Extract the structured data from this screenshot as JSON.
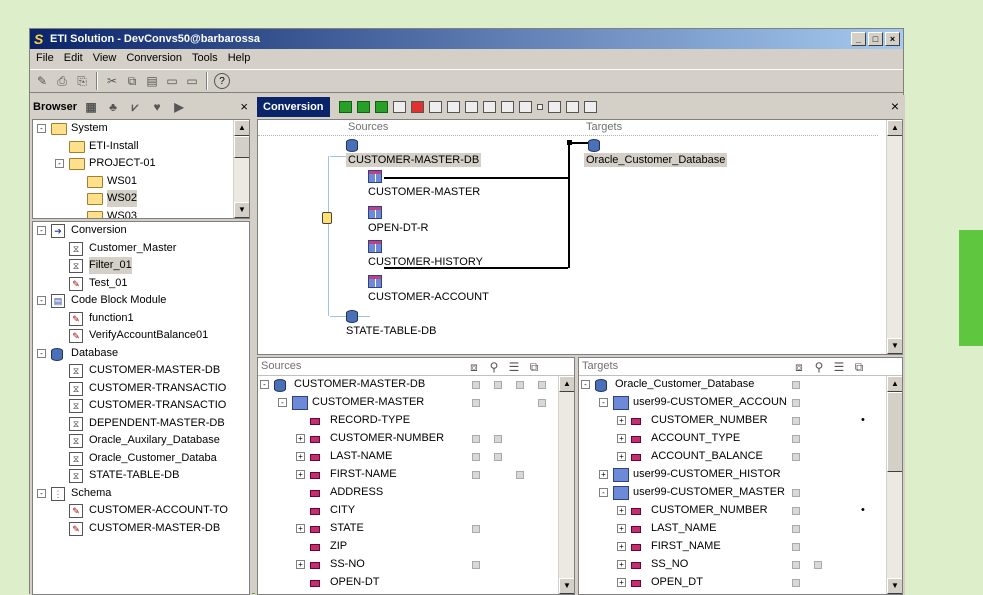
{
  "window": {
    "title": "ETI Solution - DevConvs50@barbarossa",
    "logo": "S"
  },
  "menu": [
    "File",
    "Edit",
    "View",
    "Conversion",
    "Tools",
    "Help"
  ],
  "browser": {
    "title": "Browser",
    "tree1": [
      {
        "label": "System",
        "depth": 0,
        "icon": "folder-icon",
        "exp": "-"
      },
      {
        "label": "ETI-Install",
        "depth": 1,
        "icon": "folder-icon"
      },
      {
        "label": "PROJECT-01",
        "depth": 1,
        "icon": "folder-icon",
        "exp": "-"
      },
      {
        "label": "WS01",
        "depth": 2,
        "icon": "folder-icon"
      },
      {
        "label": "WS02",
        "depth": 2,
        "icon": "folder-icon",
        "sel": true
      },
      {
        "label": "WS03",
        "depth": 2,
        "icon": "folder-icon"
      }
    ],
    "tree2": [
      {
        "label": "Conversion",
        "depth": 0,
        "icon": "conversion-icon",
        "exp": "-"
      },
      {
        "label": "Customer_Master",
        "depth": 1,
        "icon": "filter-doc-icon"
      },
      {
        "label": "Filter_01",
        "depth": 1,
        "icon": "filter-doc-icon",
        "sel": true
      },
      {
        "label": "Test_01",
        "depth": 1,
        "icon": "edit-doc-icon"
      },
      {
        "label": "Code Block Module",
        "depth": 0,
        "icon": "module-icon",
        "exp": "-"
      },
      {
        "label": "function1",
        "depth": 1,
        "icon": "edit-doc-icon"
      },
      {
        "label": "VerifyAccountBalance01",
        "depth": 1,
        "icon": "edit-doc-icon"
      },
      {
        "label": "Database",
        "depth": 0,
        "icon": "database-icon",
        "exp": "-"
      },
      {
        "label": "CUSTOMER-MASTER-DB",
        "depth": 1,
        "icon": "filter-doc-icon"
      },
      {
        "label": "CUSTOMER-TRANSACTIO",
        "depth": 1,
        "icon": "filter-doc-icon"
      },
      {
        "label": "CUSTOMER-TRANSACTIO",
        "depth": 1,
        "icon": "filter-doc-icon"
      },
      {
        "label": "DEPENDENT-MASTER-DB",
        "depth": 1,
        "icon": "filter-doc-icon"
      },
      {
        "label": "Oracle_Auxilary_Database",
        "depth": 1,
        "icon": "filter-doc-icon"
      },
      {
        "label": "Oracle_Customer_Databa",
        "depth": 1,
        "icon": "filter-doc-icon"
      },
      {
        "label": "STATE-TABLE-DB",
        "depth": 1,
        "icon": "filter-doc-icon"
      },
      {
        "label": "Schema",
        "depth": 0,
        "icon": "schema-icon",
        "exp": "-"
      },
      {
        "label": "CUSTOMER-ACCOUNT-TO",
        "depth": 1,
        "icon": "edit-doc-icon"
      },
      {
        "label": "CUSTOMER-MASTER-DB",
        "depth": 1,
        "icon": "edit-doc-icon"
      }
    ]
  },
  "conversion": {
    "title": "Conversion"
  },
  "diagram": {
    "sources_label": "Sources",
    "targets_label": "Targets",
    "source_db": "CUSTOMER-MASTER-DB",
    "target_db": "Oracle_Customer_Database",
    "tables": [
      "CUSTOMER-MASTER",
      "OPEN-DT-R",
      "CUSTOMER-HISTORY",
      "CUSTOMER-ACCOUNT"
    ],
    "state_db": "STATE-TABLE-DB"
  },
  "sources_panel": {
    "header": "Sources",
    "rows": [
      {
        "label": "CUSTOMER-MASTER-DB",
        "depth": 0,
        "kind": "db",
        "exp": "-",
        "checks": [
          1,
          1,
          1,
          1
        ]
      },
      {
        "label": "CUSTOMER-MASTER",
        "depth": 1,
        "kind": "table",
        "exp": "-",
        "checks": [
          1,
          0,
          0,
          1
        ]
      },
      {
        "label": "RECORD-TYPE",
        "depth": 2,
        "kind": "field",
        "checks": [
          0,
          0,
          0,
          0
        ]
      },
      {
        "label": "CUSTOMER-NUMBER",
        "depth": 2,
        "kind": "field",
        "exp": "+",
        "checks": [
          1,
          1,
          0,
          0
        ]
      },
      {
        "label": "LAST-NAME",
        "depth": 2,
        "kind": "field",
        "exp": "+",
        "checks": [
          1,
          1,
          0,
          0
        ]
      },
      {
        "label": "FIRST-NAME",
        "depth": 2,
        "kind": "field",
        "exp": "+",
        "checks": [
          1,
          0,
          1,
          0
        ]
      },
      {
        "label": "ADDRESS",
        "depth": 2,
        "kind": "field",
        "checks": [
          0,
          0,
          0,
          0
        ]
      },
      {
        "label": "CITY",
        "depth": 2,
        "kind": "field",
        "checks": [
          0,
          0,
          0,
          0
        ]
      },
      {
        "label": "STATE",
        "depth": 2,
        "kind": "field",
        "exp": "+",
        "checks": [
          1,
          0,
          0,
          0
        ]
      },
      {
        "label": "ZIP",
        "depth": 2,
        "kind": "field",
        "checks": [
          0,
          0,
          0,
          0
        ]
      },
      {
        "label": "SS-NO",
        "depth": 2,
        "kind": "field",
        "exp": "+",
        "checks": [
          1,
          0,
          0,
          0
        ]
      },
      {
        "label": "OPEN-DT",
        "depth": 2,
        "kind": "field",
        "checks": [
          0,
          0,
          0,
          0
        ]
      }
    ]
  },
  "targets_panel": {
    "header": "Targets",
    "rows": [
      {
        "label": "Oracle_Customer_Database",
        "depth": 0,
        "kind": "db",
        "exp": "-",
        "checks": [
          1,
          0,
          0,
          0
        ],
        "mark": ""
      },
      {
        "label": "user99-CUSTOMER_ACCOUN",
        "depth": 1,
        "kind": "table",
        "exp": "-",
        "checks": [
          1,
          0,
          0,
          0
        ],
        "mark": ""
      },
      {
        "label": "CUSTOMER_NUMBER",
        "depth": 2,
        "kind": "field",
        "exp": "+",
        "checks": [
          1,
          0,
          0,
          0
        ],
        "mark": "•"
      },
      {
        "label": "ACCOUNT_TYPE",
        "depth": 2,
        "kind": "field",
        "exp": "+",
        "checks": [
          1,
          0,
          0,
          0
        ],
        "mark": ""
      },
      {
        "label": "ACCOUNT_BALANCE",
        "depth": 2,
        "kind": "field",
        "exp": "+",
        "checks": [
          1,
          0,
          0,
          0
        ],
        "mark": ""
      },
      {
        "label": "user99-CUSTOMER_HISTOR",
        "depth": 1,
        "kind": "table",
        "exp": "+",
        "checks": [
          0,
          0,
          0,
          0
        ],
        "mark": ""
      },
      {
        "label": "user99-CUSTOMER_MASTER",
        "depth": 1,
        "kind": "table",
        "exp": "-",
        "checks": [
          1,
          0,
          0,
          0
        ],
        "mark": ""
      },
      {
        "label": "CUSTOMER_NUMBER",
        "depth": 2,
        "kind": "field",
        "exp": "+",
        "checks": [
          1,
          0,
          0,
          0
        ],
        "mark": "•"
      },
      {
        "label": "LAST_NAME",
        "depth": 2,
        "kind": "field",
        "exp": "+",
        "checks": [
          1,
          0,
          0,
          0
        ],
        "mark": ""
      },
      {
        "label": "FIRST_NAME",
        "depth": 2,
        "kind": "field",
        "exp": "+",
        "checks": [
          1,
          0,
          0,
          0
        ],
        "mark": ""
      },
      {
        "label": "SS_NO",
        "depth": 2,
        "kind": "field",
        "exp": "+",
        "checks": [
          1,
          1,
          0,
          0
        ],
        "mark": ""
      },
      {
        "label": "OPEN_DT",
        "depth": 2,
        "kind": "field",
        "exp": "+",
        "checks": [
          1,
          0,
          0,
          0
        ],
        "mark": ""
      }
    ]
  }
}
